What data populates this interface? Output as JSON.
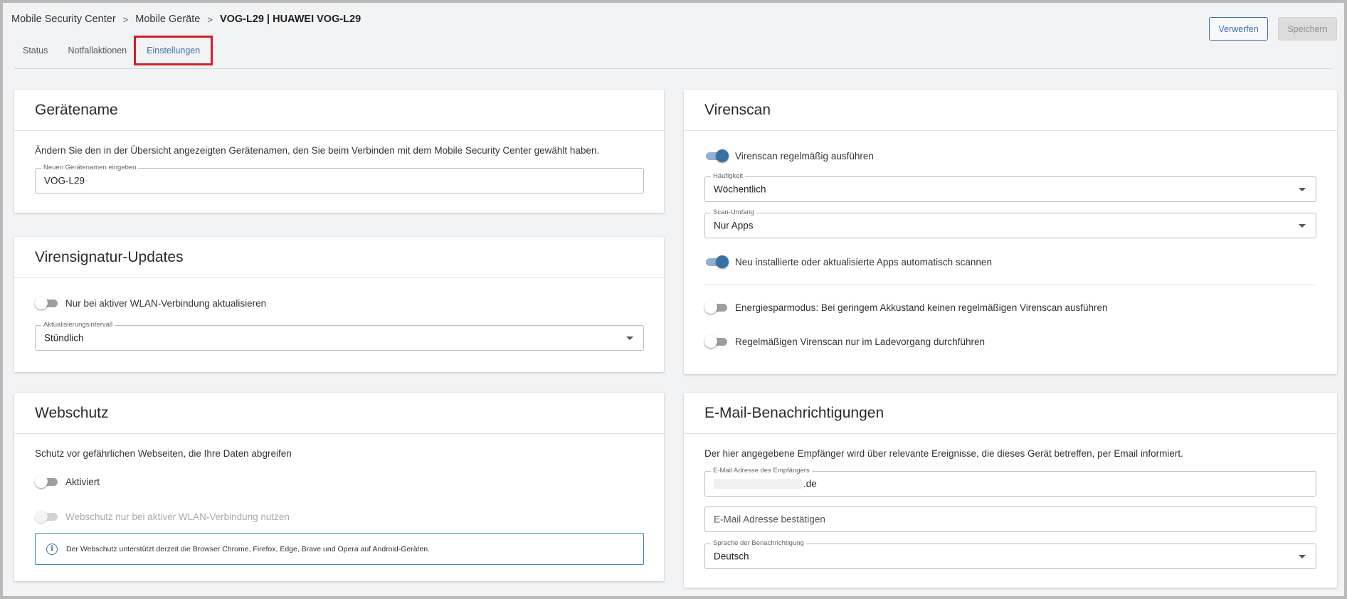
{
  "breadcrumb": {
    "items": [
      "Mobile Security Center",
      "Mobile Geräte"
    ],
    "current": "VOG-L29 | HUAWEI VOG-L29",
    "separator": ">"
  },
  "tabs": {
    "status": "Status",
    "notfall": "Notfallaktionen",
    "einstellungen": "Einstellungen"
  },
  "actions": {
    "discard": "Verwerfen",
    "save": "Speichern"
  },
  "geraetename": {
    "title": "Gerätename",
    "description": "Ändern Sie den in der Übersicht angezeigten Gerätenamen, den Sie beim Verbinden mit dem Mobile Security Center gewählt haben.",
    "input_label": "Neuen Gerätenamen eingeben",
    "input_value": "VOG-L29"
  },
  "signatur": {
    "title": "Virensignatur-Updates",
    "wlan_toggle_label": "Nur bei aktiver WLAN-Verbindung aktualisieren",
    "interval_label": "Aktualisierungsintervall",
    "interval_value": "Stündlich"
  },
  "webschutz": {
    "title": "Webschutz",
    "description": "Schutz vor gefährlichen Webseiten, die Ihre Daten abgreifen",
    "enabled_label": "Aktiviert",
    "wlan_label": "Webschutz nur bei aktiver WLAN-Verbindung nutzen",
    "info": "Der Webschutz unterstützt derzeit die Browser Chrome, Firefox, Edge, Brave und Opera auf Android-Geräten."
  },
  "virenscan": {
    "title": "Virenscan",
    "regular_label": "Virenscan regelmäßig ausführen",
    "frequency_label": "Häufigkeit",
    "frequency_value": "Wöchentlich",
    "scope_label": "Scan-Umfang",
    "scope_value": "Nur Apps",
    "auto_scan_label": "Neu installierte oder aktualisierte Apps automatisch scannen",
    "energy_label": "Energiesparmodus: Bei geringem Akkustand keinen regelmäßigen Virenscan ausführen",
    "charging_label": "Regelmäßigen Virenscan nur im Ladevorgang durchführen"
  },
  "email": {
    "title": "E-Mail-Benachrichtigungen",
    "description": "Der hier angegebene Empfänger wird über relevante Ereignisse, die dieses Gerät betreffen, per Email informiert.",
    "recipient_label": "E-Mail Adresse des Empfängers",
    "recipient_suffix": ".de",
    "confirm_placeholder": "E-Mail Adresse bestätigen",
    "language_label": "Sprache der Benachrichtigung",
    "language_value": "Deutsch"
  },
  "colors": {
    "accent": "#3a6ea5",
    "highlight": "#d0202a"
  }
}
